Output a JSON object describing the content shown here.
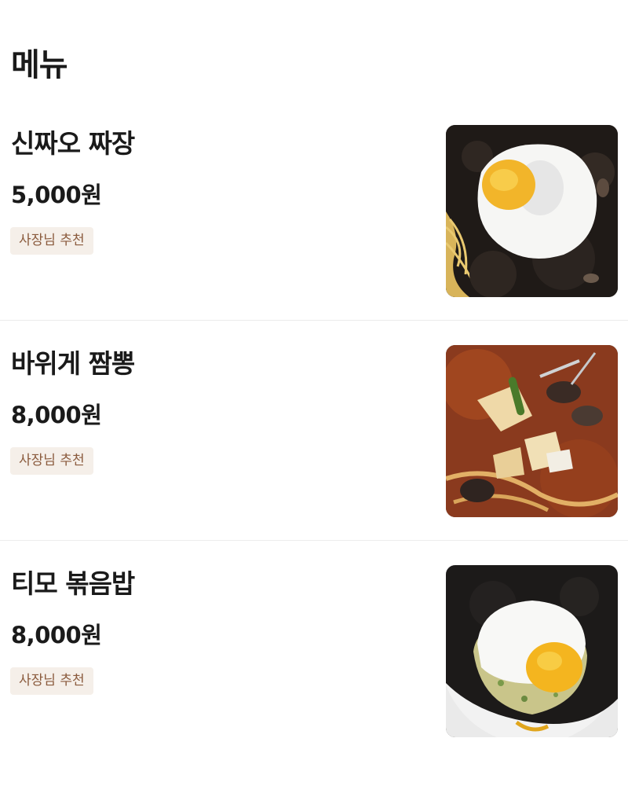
{
  "section": {
    "title": "메뉴"
  },
  "menu": {
    "items": [
      {
        "name": "신짜오 짜장",
        "price": "5,000원",
        "badge": "사장님 추천",
        "photo": "jjajang-with-fried-egg-photo"
      },
      {
        "name": "바위게 짬뽕",
        "price": "8,000원",
        "badge": "사장님 추천",
        "photo": "jjamppong-seafood-noodle-photo"
      },
      {
        "name": "티모 볶음밥",
        "price": "8,000원",
        "badge": "사장님 추천",
        "photo": "fried-rice-with-egg-and-black-sauce-photo"
      }
    ]
  },
  "colors": {
    "badge_background": "#f5efe9",
    "badge_text": "#8a5a3c",
    "divider": "#ececec"
  }
}
